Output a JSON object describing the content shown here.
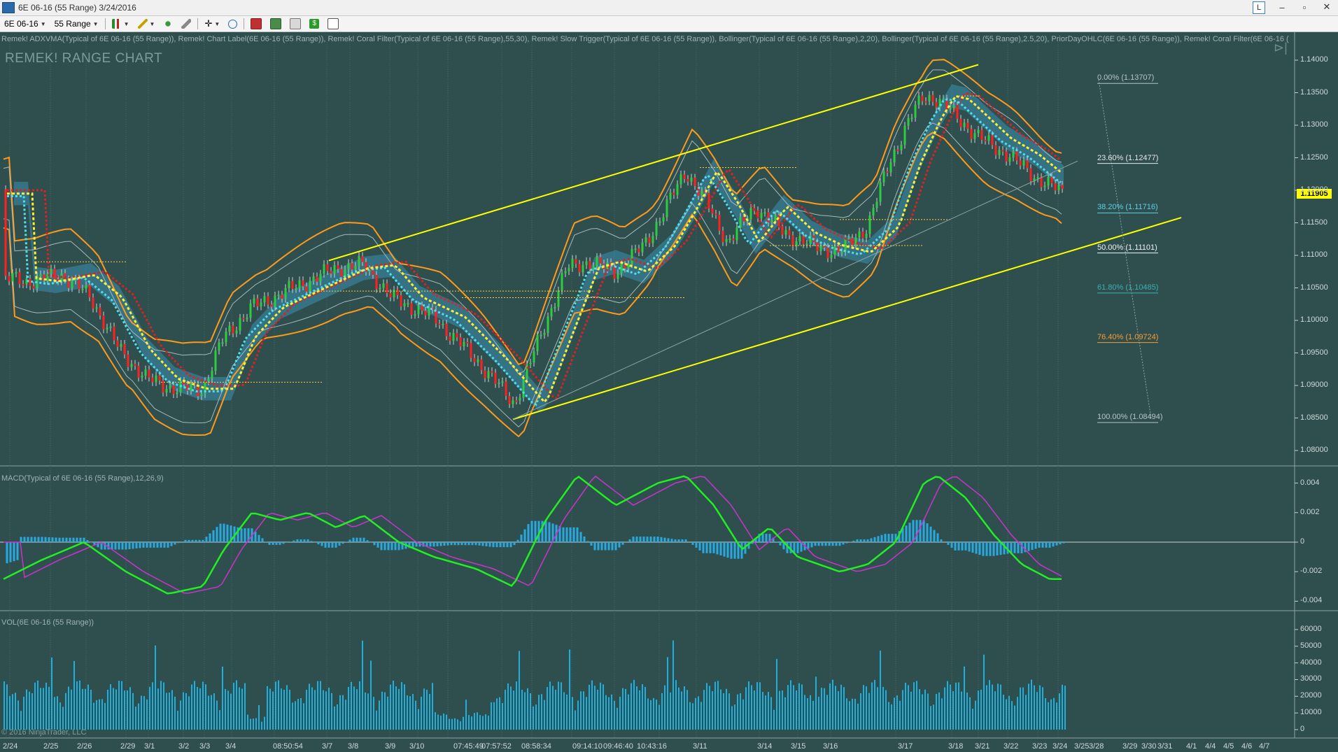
{
  "window": {
    "title": "6E 06-16 (55 Range)  3/24/2016",
    "btn_l": "L",
    "btn_min": "–",
    "btn_max": "▫",
    "btn_close": "✕"
  },
  "toolbar": {
    "instrument": "6E 06-16",
    "period": "55 Range"
  },
  "chart": {
    "indicators_text": "Remek! ADXVMA(Typical of 6E 06-16 (55 Range)), Remek! Chart Label(6E 06-16 (55 Range)), Remek! Coral Filter(Typical of 6E 06-16 (55 Range),55,30), Remek! Slow Trigger(Typical of 6E 06-16 (55 Range)), Bollinger(Typical of 6E 06-16 (55 Range),2,20), Bollinger(Typical of 6E 06-16 (55 Range),2.5,20), PriorDayOHLC(6E 06-16 (55 Range)), Remek! Coral Filter(6E 06-16 (",
    "label": "REMEK! RANGE CHART",
    "last_price": "1.11905",
    "macd_label": "MACD(Typical of 6E 06-16 (55 Range),12,26,9)",
    "vol_label": "VOL(6E 06-16 (55 Range))",
    "copyright": "© 2016 NinjaTrader, LLC",
    "price_ticks": [
      "1.14000",
      "1.13500",
      "1.13000",
      "1.12500",
      "1.12000",
      "1.11500",
      "1.11000",
      "1.10500",
      "1.10000",
      "1.09500",
      "1.09000",
      "1.08500",
      "1.08000"
    ],
    "macd_ticks": [
      "0.004",
      "0.002",
      "0",
      "-0.002",
      "-0.004"
    ],
    "vol_ticks": [
      "60000",
      "50000",
      "40000",
      "30000",
      "20000",
      "10000",
      "0"
    ],
    "fib": [
      {
        "text": "0.00% (1.13707)",
        "color": "#b8c4c4"
      },
      {
        "text": "23.60% (1.12477)",
        "color": "#e8e8e8"
      },
      {
        "text": "38.20% (1.11716)",
        "color": "#5fd0e8"
      },
      {
        "text": "50.00% (1.11101)",
        "color": "#f2f2f2"
      },
      {
        "text": "61.80% (1.10485)",
        "color": "#3ab0b0"
      },
      {
        "text": "76.40% (1.09724)",
        "color": "#ff9a30"
      },
      {
        "text": "100.00% (1.08494)",
        "color": "#b8c4c4"
      }
    ],
    "x_labels": [
      "2/24",
      "2/25",
      "2/26",
      "2/29",
      "3/1",
      "3/2",
      "3/3",
      "3/4",
      "08:50:54",
      "3/7",
      "3/8",
      "3/9",
      "3/10",
      "07:45:49",
      "07:57:52",
      "08:58:34",
      "09:14:10",
      "09:46:40",
      "10:43:16",
      "3/11",
      "3/14",
      "3/15",
      "3/16",
      "3/17",
      "3/18",
      "3/21",
      "3/22",
      "3/23",
      "3/24",
      "3/25",
      "3/28",
      "3/29",
      "3/30",
      "3/31",
      "4/1",
      "4/4",
      "4/5",
      "4/6",
      "4/7"
    ],
    "colors": {
      "background": "#2f4f4f",
      "up": "#2ecc40",
      "down": "#ff2020",
      "channel": "#ffff00",
      "bollinger": "#ff9a1a",
      "coral": "#4dc8e8",
      "macd": "#22ee22",
      "signal": "#cc33cc",
      "hist": "#2aa8e0",
      "vol": "#1fb0e0"
    }
  }
}
